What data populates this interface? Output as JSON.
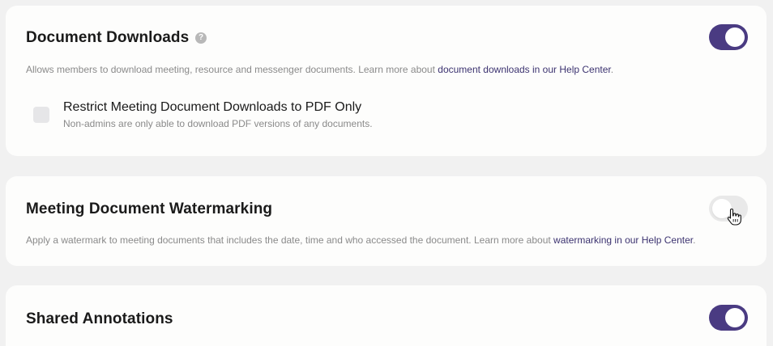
{
  "document_downloads": {
    "title": "Document Downloads",
    "help_icon": "?",
    "description": "Allows members to download meeting, resource and messenger documents. Learn more about ",
    "link": "document downloads in our Help Center",
    "description_end": ".",
    "toggle_on": true,
    "option": {
      "title": "Restrict Meeting Document Downloads to PDF Only",
      "description": "Non-admins are only able to download PDF versions of any documents.",
      "checked": false
    }
  },
  "watermarking": {
    "title": "Meeting Document Watermarking",
    "description": "Apply a watermark to meeting documents that includes the date, time and who accessed the document. Learn more about ",
    "link": "watermarking in our Help Center",
    "description_end": ".",
    "toggle_on": false
  },
  "shared_annotations": {
    "title": "Shared Annotations",
    "toggle_on": true
  },
  "colors": {
    "accent": "#4a3b82",
    "link": "#3c3370",
    "muted_text": "#8a8a8a",
    "page_background": "#f1f1f1"
  },
  "icons": {
    "help": "question-circle-icon",
    "cursor": "hand-pointer-icon"
  }
}
